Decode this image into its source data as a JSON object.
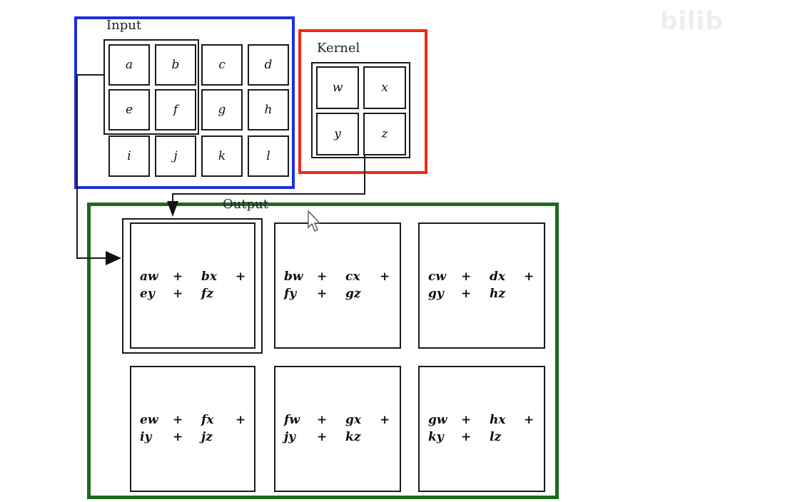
{
  "watermark": "bilib",
  "input": {
    "label": "Input",
    "cells": [
      [
        "a",
        "b",
        "c",
        "d"
      ],
      [
        "e",
        "f",
        "g",
        "h"
      ],
      [
        "i",
        "j",
        "k",
        "l"
      ]
    ]
  },
  "kernel": {
    "label": "Kernel",
    "cells": [
      [
        "w",
        "x"
      ],
      [
        "y",
        "z"
      ]
    ]
  },
  "output": {
    "label": "Output",
    "cells": [
      [
        {
          "a": "aw",
          "b": "bx",
          "c": "ey",
          "d": "fz"
        },
        {
          "a": "bw",
          "b": "cx",
          "c": "fy",
          "d": "gz"
        },
        {
          "a": "cw",
          "b": "dx",
          "c": "gy",
          "d": "hz"
        }
      ],
      [
        {
          "a": "ew",
          "b": "fx",
          "c": "iy",
          "d": "jz"
        },
        {
          "a": "fw",
          "b": "gx",
          "c": "jy",
          "d": "kz"
        },
        {
          "a": "gw",
          "b": "hx",
          "c": "ky",
          "d": "lz"
        }
      ]
    ],
    "plus": "+"
  },
  "colors": {
    "input_frame": "#1a2ee0",
    "kernel_frame": "#ee2a12",
    "output_frame": "#1e6a1e",
    "lines": "#1a1a1a"
  }
}
